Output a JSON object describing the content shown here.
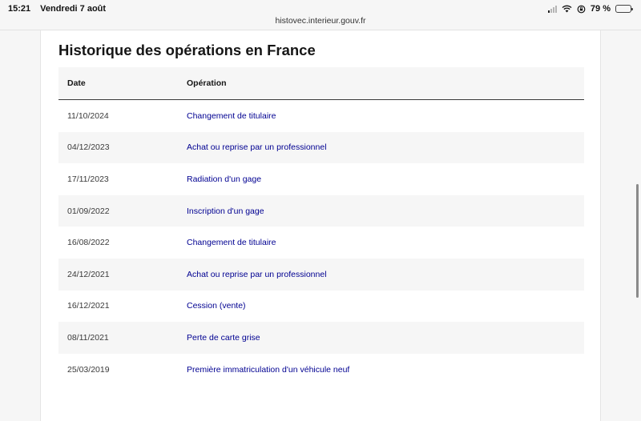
{
  "status_bar": {
    "time": "15:21",
    "date": "Vendredi 7 août",
    "battery": "79 %",
    "battery_level": 0.79,
    "icons": [
      "signal-icon",
      "wifi-icon",
      "orientation-lock-icon",
      "battery-icon"
    ]
  },
  "browser": {
    "url": "histovec.interieur.gouv.fr"
  },
  "page": {
    "title": "Historique des opérations en France"
  },
  "table": {
    "headers": {
      "date": "Date",
      "operation": "Opération"
    },
    "rows": [
      {
        "date": "11/10/2024",
        "operation": "Changement de titulaire"
      },
      {
        "date": "04/12/2023",
        "operation": "Achat ou reprise par un professionnel"
      },
      {
        "date": "17/11/2023",
        "operation": "Radiation d'un gage"
      },
      {
        "date": "01/09/2022",
        "operation": "Inscription d'un gage"
      },
      {
        "date": "16/08/2022",
        "operation": "Changement de titulaire"
      },
      {
        "date": "24/12/2021",
        "operation": "Achat ou reprise par un professionnel"
      },
      {
        "date": "16/12/2021",
        "operation": "Cession (vente)"
      },
      {
        "date": "08/11/2021",
        "operation": "Perte de carte grise"
      },
      {
        "date": "25/03/2019",
        "operation": "Première immatriculation d'un véhicule neuf"
      }
    ]
  },
  "colors": {
    "link": "#000091",
    "header_bg": "#f6f6f6",
    "stripe_bg": "#f6f6f6"
  }
}
